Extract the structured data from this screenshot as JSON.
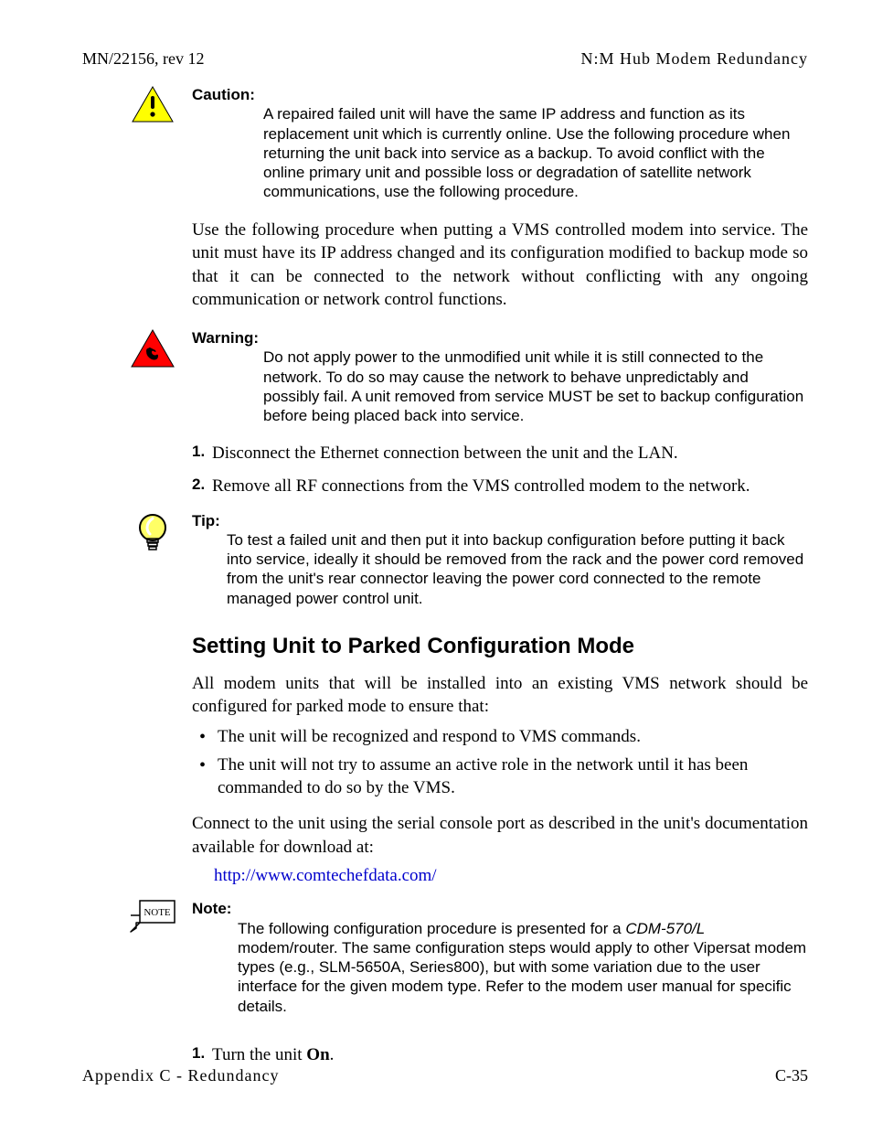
{
  "header": {
    "left": "MN/22156, rev 12",
    "right": "N:M Hub Modem Redundancy"
  },
  "admonitions": {
    "caution": {
      "label": "Caution:",
      "text": "A repaired failed unit will have the same IP address and function as its replacement unit which is currently online. Use the following procedure when returning the unit back into service as a backup. To avoid conflict with the online primary unit and possible loss or degradation of satellite network communications, use the following procedure."
    },
    "warning": {
      "label": "Warning:",
      "text": "Do not apply power to the unmodified unit while it is still connected to the network. To do so may cause the network to behave unpredictably and possibly fail. A unit removed from service MUST be set to backup configuration before being placed back into service."
    },
    "tip": {
      "label": "Tip:",
      "text": "To test a failed unit and then put it into backup configuration before putting it back into service, ideally it should be removed from the rack and the power cord removed from the unit's rear connector leaving the power cord connected to the remote managed power control unit."
    },
    "note": {
      "label": "Note:",
      "text_pre": "The following configuration procedure is presented for a ",
      "model": "CDM-570/L",
      "text_post": " modem/router. The same configuration steps would apply to other Vipersat modem types (e.g., SLM-5650A, Series800), but with some variation due to the user interface for the given modem type. Refer to the modem user manual for specific details."
    }
  },
  "para_intro": "Use the following procedure when putting a VMS controlled modem into service. The unit must have its IP address changed and its configuration modified to backup mode so that it can be connected to the network without conflicting with any ongoing communication or network control functions.",
  "steps_a": {
    "s1_num": "1.",
    "s1": "Disconnect the Ethernet connection between the unit and the LAN.",
    "s2_num": "2.",
    "s2": "Remove all RF connections from the VMS controlled modem to the network."
  },
  "section_heading": "Setting Unit to Parked Configuration Mode",
  "para_section": "All modem units that will be installed into an existing VMS network should be configured for parked mode to ensure that:",
  "bullets": {
    "b1": "The unit will be recognized and respond to VMS commands.",
    "b2": "The unit will not try to assume an active role in the network until it has been commanded to do so by the VMS."
  },
  "para_connect": "Connect to the unit using the serial console port as described in the unit's documentation available for download at:",
  "link": "http://www.comtechefdata.com/",
  "steps_b": {
    "s1_num": "1.",
    "s1_pre": "Turn the unit ",
    "s1_bold": "On",
    "s1_post": "."
  },
  "footer": {
    "left": "Appendix C - Redundancy",
    "right": "C-35"
  },
  "note_icon_text": "NOTE"
}
